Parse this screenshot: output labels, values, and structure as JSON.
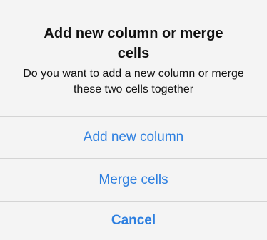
{
  "alert": {
    "title": "Add new column or merge cells",
    "message": "Do you want to add a new column or merge these two cells together",
    "actions": [
      {
        "label": "Add new column",
        "style": "default"
      },
      {
        "label": "Merge cells",
        "style": "default"
      },
      {
        "label": "Cancel",
        "style": "cancel"
      }
    ]
  },
  "colors": {
    "action_text": "#2d7fe0",
    "background": "#f4f4f4",
    "divider": "#d4d4d4"
  }
}
